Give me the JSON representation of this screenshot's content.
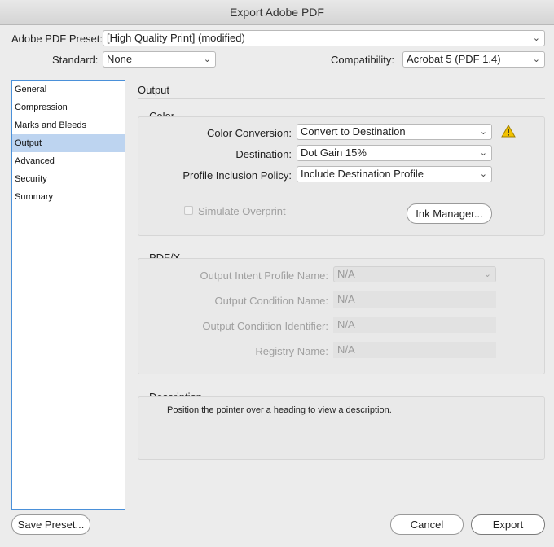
{
  "window": {
    "title": "Export Adobe PDF"
  },
  "top": {
    "preset_label": "Adobe PDF Preset:",
    "preset_value": "[High Quality Print] (modified)",
    "standard_label": "Standard:",
    "standard_value": "None",
    "compat_label": "Compatibility:",
    "compat_value": "Acrobat 5 (PDF 1.4)"
  },
  "sidebar": {
    "items": [
      {
        "label": "General"
      },
      {
        "label": "Compression"
      },
      {
        "label": "Marks and Bleeds"
      },
      {
        "label": "Output"
      },
      {
        "label": "Advanced"
      },
      {
        "label": "Security"
      },
      {
        "label": "Summary"
      }
    ],
    "selected": "Output"
  },
  "panel": {
    "title": "Output"
  },
  "color": {
    "heading": "Color",
    "conversion_label": "Color Conversion:",
    "conversion_value": "Convert to Destination",
    "destination_label": "Destination:",
    "destination_value": "Dot Gain 15%",
    "policy_label": "Profile Inclusion Policy:",
    "policy_value": "Include Destination Profile",
    "simulate_label": "Simulate Overprint",
    "ink_manager_label": "Ink Manager..."
  },
  "pdfx": {
    "heading": "PDF/X",
    "intent_label": "Output Intent Profile Name:",
    "intent_value": "N/A",
    "condition_label": "Output Condition Name:",
    "condition_value": "N/A",
    "identifier_label": "Output Condition Identifier:",
    "identifier_value": "N/A",
    "registry_label": "Registry Name:",
    "registry_value": "N/A"
  },
  "description": {
    "heading": "Description",
    "text": "Position the pointer over a heading to view a description."
  },
  "buttons": {
    "save_preset": "Save Preset...",
    "cancel": "Cancel",
    "export": "Export"
  },
  "icons": {
    "warning": "warning-icon",
    "chevron": "chevron-down-icon"
  },
  "colors": {
    "selection": "#bdd4f0",
    "sidebar_border": "#4a90d9",
    "warning": "#f2c200"
  }
}
